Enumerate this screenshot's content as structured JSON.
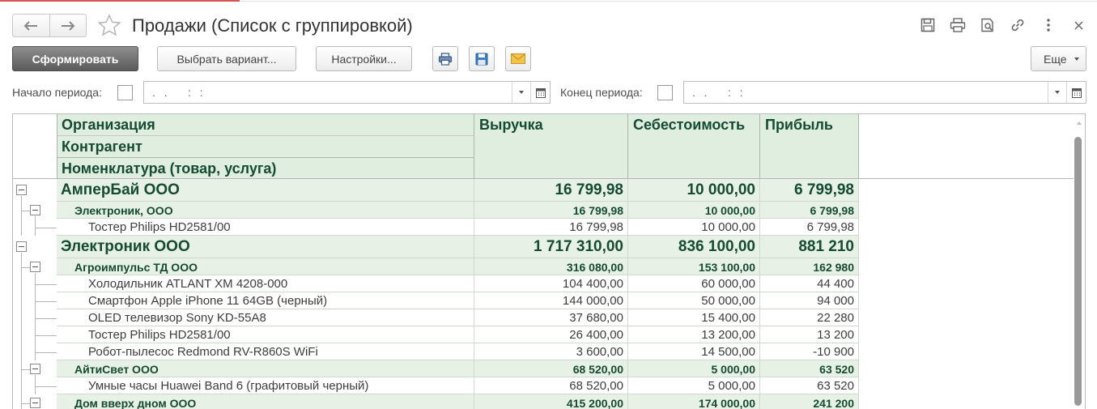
{
  "window": {
    "title": "Продажи (Список с группировкой)",
    "icons": [
      "back-arrow-icon",
      "forward-arrow-icon",
      "star-icon",
      "save-icon",
      "print-icon",
      "preview-icon",
      "link-icon",
      "more-vertical-icon",
      "close-icon"
    ]
  },
  "toolbar": {
    "generate_label": "Сформировать",
    "choose_variant_label": "Выбрать вариант...",
    "settings_label": "Настройки...",
    "more_label": "Еще"
  },
  "period": {
    "start_label": "Начало периода:",
    "start_value": ".  .     :  :",
    "end_label": "Конец периода:",
    "end_value": ".  .     :  :"
  },
  "report": {
    "headers": {
      "group_levels": [
        "Организация",
        "Контрагент",
        "Номенклатура (товар, услуга)"
      ],
      "revenue": "Выручка",
      "cost": "Себестоимость",
      "profit": "Прибыль"
    },
    "rows": [
      {
        "level": 1,
        "name": "АмперБай ООО",
        "revenue": "16 799,98",
        "cost": "10 000,00",
        "profit": "6 799,98"
      },
      {
        "level": 2,
        "name": "Электроник, ООО",
        "revenue": "16 799,98",
        "cost": "10 000,00",
        "profit": "6 799,98"
      },
      {
        "level": 3,
        "name": "Тостер Philips HD2581/00",
        "revenue": "16 799,98",
        "cost": "10 000,00",
        "profit": "6 799,98"
      },
      {
        "level": 1,
        "name": "Электроник ООО",
        "revenue": "1 717 310,00",
        "cost": "836 100,00",
        "profit": "881 210"
      },
      {
        "level": 2,
        "name": "Агроимпульс ТД ООО",
        "revenue": "316 080,00",
        "cost": "153 100,00",
        "profit": "162 980"
      },
      {
        "level": 3,
        "name": "Холодильник ATLANT ХМ 4208-000",
        "revenue": "104 400,00",
        "cost": "60 000,00",
        "profit": "44 400"
      },
      {
        "level": 3,
        "name": "Смартфон Apple iPhone 11 64GB (черный)",
        "revenue": "144 000,00",
        "cost": "50 000,00",
        "profit": "94 000"
      },
      {
        "level": 3,
        "name": "OLED телевизор Sony KD-55A8",
        "revenue": "37 680,00",
        "cost": "15 400,00",
        "profit": "22 280"
      },
      {
        "level": 3,
        "name": "Тостер Philips HD2581/00",
        "revenue": "26 400,00",
        "cost": "13 200,00",
        "profit": "13 200"
      },
      {
        "level": 3,
        "name": "Робот-пылесос Redmond RV-R860S WiFi",
        "revenue": "3 600,00",
        "cost": "14 500,00",
        "profit": "-10 900"
      },
      {
        "level": 2,
        "name": "АйтиСвет ООО",
        "revenue": "68 520,00",
        "cost": "5 000,00",
        "profit": "63 520"
      },
      {
        "level": 3,
        "name": "Умные часы Huawei Band 6 (графитовый черный)",
        "revenue": "68 520,00",
        "cost": "5 000,00",
        "profit": "63 520"
      },
      {
        "level": 2,
        "name": "Дом вверх дном ООО",
        "revenue": "415 200,00",
        "cost": "174 000,00",
        "profit": "241 200"
      }
    ]
  },
  "colors": {
    "header_fill": "#dfeede",
    "group_fill": "#e7f1e5",
    "header_text": "#154a33",
    "accent_red": "#d9534f"
  }
}
